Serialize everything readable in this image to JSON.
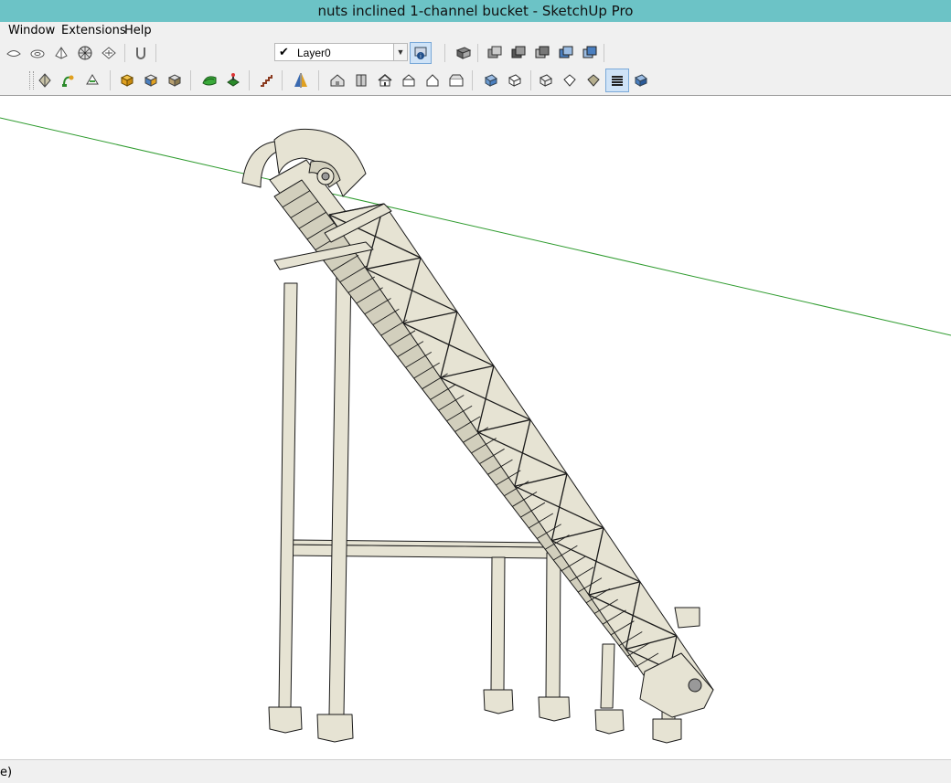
{
  "window": {
    "title": "nuts inclined 1-channel bucket - SketchUp Pro"
  },
  "menu": {
    "items": [
      {
        "label": "Window"
      },
      {
        "label": "Extensions"
      },
      {
        "label": "Help"
      }
    ]
  },
  "toolbar1": {
    "sandbox_icons": [
      "smoove-icon",
      "stamp-icon",
      "drape-icon",
      "add-detail-icon",
      "flip-edge-icon",
      "magnet-icon"
    ],
    "layer": {
      "current": "Layer0",
      "checked": "✔"
    },
    "layer_manager_icon": "layer-manager-icon",
    "view_icons": [
      "section-plane-icon",
      "view-iso-icon",
      "view-top-icon",
      "view-front-icon",
      "view-right-icon",
      "view-back-icon"
    ]
  },
  "toolbar2": {
    "icons": [
      "shadow-icon",
      "warehouse-icon",
      "share-icon",
      "solid-union-icon",
      "solid-subtract-icon",
      "solid-trim-icon",
      "terrain-icon",
      "location-icon",
      "stairs-icon",
      "mirror-icon",
      "house-iso-icon",
      "house-side-icon",
      "house-front-icon",
      "house-right-icon",
      "house-back-icon",
      "house-left-icon",
      "xray-icon",
      "back-edges-icon",
      "wireframe-icon",
      "hidden-line-icon",
      "shaded-icon",
      "shaded-textures-icon",
      "monochrome-icon"
    ],
    "active_style": "shaded-textures-icon"
  },
  "viewport": {
    "model_name": "inclined bucket conveyor",
    "axis_color": "#2e9b2e",
    "model_fill": "#e6e3d3",
    "model_stroke": "#1a1a1a"
  },
  "status": {
    "text": "e)"
  }
}
